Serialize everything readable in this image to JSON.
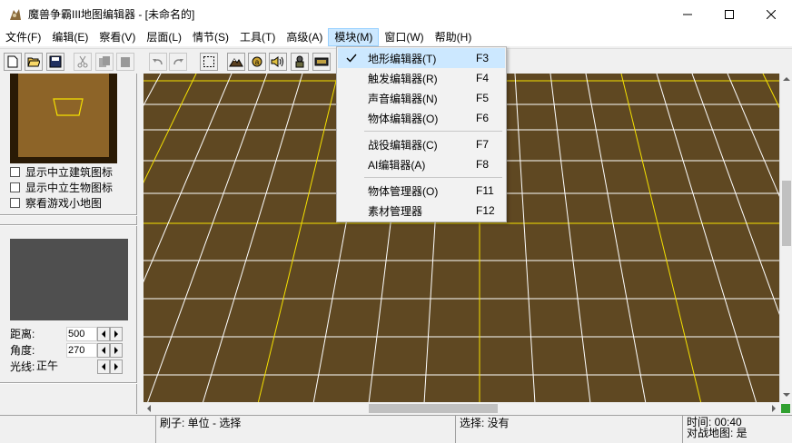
{
  "window": {
    "title": "魔兽争霸III地图编辑器 - [未命名的]",
    "icon": "world-editor-icon"
  },
  "menubar": {
    "items": [
      {
        "label": "文件(F)"
      },
      {
        "label": "编辑(E)"
      },
      {
        "label": "察看(V)"
      },
      {
        "label": "层面(L)"
      },
      {
        "label": "情节(S)"
      },
      {
        "label": "工具(T)"
      },
      {
        "label": "高级(A)"
      },
      {
        "label": "模块(M)",
        "active": true
      },
      {
        "label": "窗口(W)"
      },
      {
        "label": "帮助(H)"
      }
    ]
  },
  "module_menu": {
    "items": [
      {
        "label": "地形编辑器(T)",
        "key": "F3",
        "checked": true
      },
      {
        "label": "触发编辑器(R)",
        "key": "F4"
      },
      {
        "label": "声音编辑器(N)",
        "key": "F5"
      },
      {
        "label": "物体编辑器(O)",
        "key": "F6"
      },
      {
        "label": "战役编辑器(C)",
        "key": "F7"
      },
      {
        "label": "AI编辑器(A)",
        "key": "F8"
      },
      {
        "label": "物体管理器(O)",
        "key": "F11"
      },
      {
        "label": "素材管理器",
        "key": "F12"
      }
    ]
  },
  "left_panel": {
    "checkboxes": [
      {
        "label": "显示中立建筑图标"
      },
      {
        "label": "显示中立生物图标"
      },
      {
        "label": "察看游戏小地图"
      }
    ],
    "params": {
      "distance_label": "距离:",
      "distance_value": "500",
      "angle_label": "角度:",
      "angle_value": "270",
      "light_label": "光线:",
      "light_value": "正午"
    }
  },
  "statusbar": {
    "brush": "刷子: 单位 - 选择",
    "selection": "选择: 没有",
    "time": "时间: 00:40",
    "melee_map": "对战地图: 是"
  },
  "colors": {
    "terrain": "#6b5128",
    "grid_white": "#ffffff",
    "grid_yellow": "#f5e100",
    "menu_highlight": "#cce8ff"
  }
}
